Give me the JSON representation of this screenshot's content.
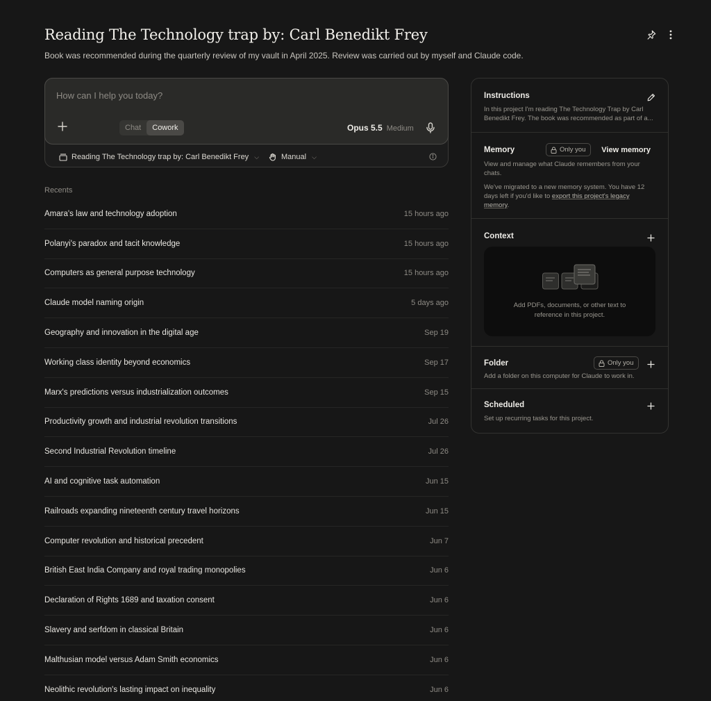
{
  "page": {
    "title": "Reading The Technology trap by: Carl Benedikt Frey",
    "subtitle": "Book was recommended during the quarterly review of my vault in April 2025. Review was carried out by myself and Claude code."
  },
  "composer": {
    "placeholder": "How can I help you today?",
    "modes": [
      "Chat",
      "Cowork"
    ],
    "active_mode": "Cowork",
    "model": "Opus 5.5",
    "effort": "Medium",
    "project_label": "Reading The Technology trap by: Carl Benedikt Frey",
    "permission_label": "Manual"
  },
  "recents": {
    "title": "Recents",
    "items": [
      {
        "title": "Amara's law and technology adoption",
        "time": "15 hours ago"
      },
      {
        "title": "Polanyi's paradox and tacit knowledge",
        "time": "15 hours ago"
      },
      {
        "title": "Computers as general purpose technology",
        "time": "15 hours ago"
      },
      {
        "title": "Claude model naming origin",
        "time": "5 days ago"
      },
      {
        "title": "Geography and innovation in the digital age",
        "time": "Sep 19"
      },
      {
        "title": "Working class identity beyond economics",
        "time": "Sep 17"
      },
      {
        "title": "Marx's predictions versus industrialization outcomes",
        "time": "Sep 15"
      },
      {
        "title": "Productivity growth and industrial revolution transitions",
        "time": "Jul 26"
      },
      {
        "title": "Second Industrial Revolution timeline",
        "time": "Jul 26"
      },
      {
        "title": "AI and cognitive task automation",
        "time": "Jun 15"
      },
      {
        "title": "Railroads expanding nineteenth century travel horizons",
        "time": "Jun 15"
      },
      {
        "title": "Computer revolution and historical precedent",
        "time": "Jun 7"
      },
      {
        "title": "British East India Company and royal trading monopolies",
        "time": "Jun 6"
      },
      {
        "title": "Declaration of Rights 1689 and taxation consent",
        "time": "Jun 6"
      },
      {
        "title": "Slavery and serfdom in classical Britain",
        "time": "Jun 6"
      },
      {
        "title": "Malthusian model versus Adam Smith economics",
        "time": "Jun 6"
      },
      {
        "title": "Neolithic revolution's lasting impact on inequality",
        "time": "Jun 6"
      }
    ]
  },
  "sidebar": {
    "instructions": {
      "title": "Instructions",
      "text": "In this project I'm reading The Technology Trap by Carl Benedikt Frey. The book was recommended as part of a..."
    },
    "memory": {
      "title": "Memory",
      "badge": "Only you",
      "link": "View memory",
      "text": "View and manage what Claude remembers from your chats.",
      "migration_text": "We've migrated to a new memory system. You have 12 days left if you'd like to",
      "migration_link": "export this project's legacy memory",
      "migration_end": "."
    },
    "context": {
      "title": "Context",
      "text": "Add PDFs, documents, or other text to reference in this project."
    },
    "folder": {
      "title": "Folder",
      "badge": "Only you",
      "text": "Add a folder on this computer for Claude to work in."
    },
    "scheduled": {
      "title": "Scheduled",
      "text": "Set up recurring tasks for this project."
    }
  }
}
